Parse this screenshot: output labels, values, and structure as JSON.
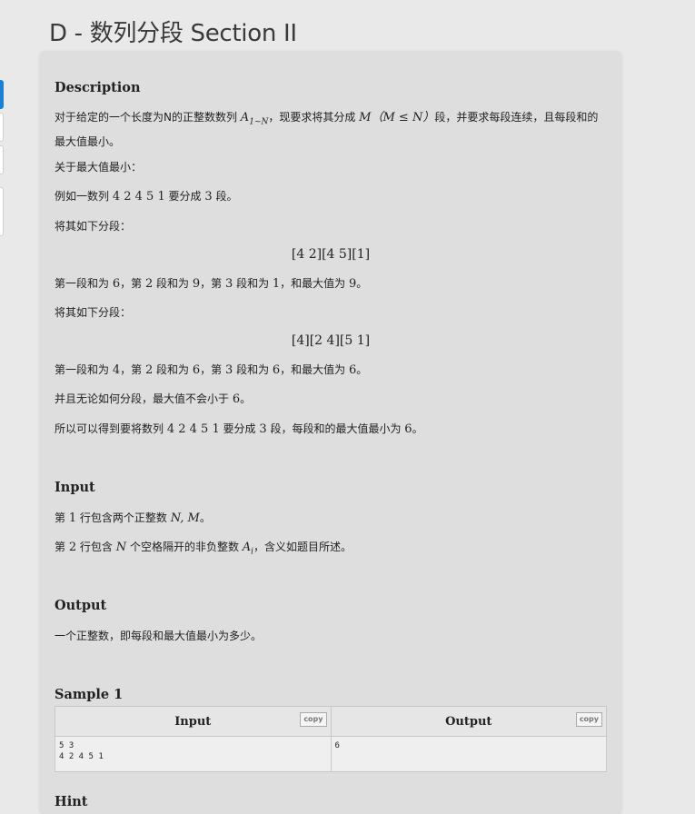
{
  "page_title": "D - 数列分段 Section II",
  "description": {
    "heading": "Description",
    "p1_a": "对于给定的一个长度为N的正整数数列 ",
    "p1_math_A": "A",
    "p1_math_sub": "1∼N",
    "p1_b": "，现要求将其分成 ",
    "p1_math_M": "M",
    "p1_math_cond": "（M ≤ N）",
    "p1_c": "段，并要求每段连续，且每段和的最大值最小。",
    "p2": "关于最大值最小：",
    "p3_a": "例如一数列 ",
    "p3_seq": "4 2 4 5 1",
    "p3_b": " 要分成 ",
    "p3_n": "3",
    "p3_c": " 段。",
    "p4": "将其如下分段：",
    "split1": "[4 2][4 5][1]",
    "p5_a": "第一段和为 ",
    "p5_v1": "6",
    "p5_b": "，第 ",
    "p5_i2": "2",
    "p5_c": " 段和为 ",
    "p5_v2": "9",
    "p5_d": "，第 ",
    "p5_i3": "3",
    "p5_e": " 段和为 ",
    "p5_v3": "1",
    "p5_f": "，和最大值为 ",
    "p5_max": "9",
    "p5_g": "。",
    "p6": "将其如下分段：",
    "split2": "[4][2 4][5 1]",
    "p7_a": "第一段和为 ",
    "p7_v1": "4",
    "p7_b": "，第 ",
    "p7_i2": "2",
    "p7_c": " 段和为 ",
    "p7_v2": "6",
    "p7_d": "，第 ",
    "p7_i3": "3",
    "p7_e": " 段和为 ",
    "p7_v3": "6",
    "p7_f": "，和最大值为 ",
    "p7_max": "6",
    "p7_g": "。",
    "p8_a": "并且无论如何分段，最大值不会小于 ",
    "p8_v": "6",
    "p8_b": "。",
    "p9_a": "所以可以得到要将数列 ",
    "p9_seq": "4 2 4 5 1",
    "p9_b": " 要分成 ",
    "p9_n": "3",
    "p9_c": " 段，每段和的最大值最小为 ",
    "p9_v": "6",
    "p9_d": "。"
  },
  "input": {
    "heading": "Input",
    "l1_a": "第 ",
    "l1_n": "1",
    "l1_b": " 行包含两个正整数 ",
    "l1_math": "N, M",
    "l1_c": "。",
    "l2_a": "第 ",
    "l2_n": "2",
    "l2_b": " 行包含 ",
    "l2_math": "N",
    "l2_c": " 个空格隔开的非负整数 ",
    "l2_math2": "A",
    "l2_sub": "i",
    "l2_d": "，含义如题目所述。"
  },
  "output": {
    "heading": "Output",
    "text": "一个正整数，即每段和最大值最小为多少。"
  },
  "sample": {
    "heading": "Sample 1",
    "input_header": "Input",
    "output_header": "Output",
    "copy_label": "copy",
    "input_value": "5 3\n4 2 4 5 1",
    "output_value": "6"
  },
  "hint": {
    "heading": "Hint"
  }
}
